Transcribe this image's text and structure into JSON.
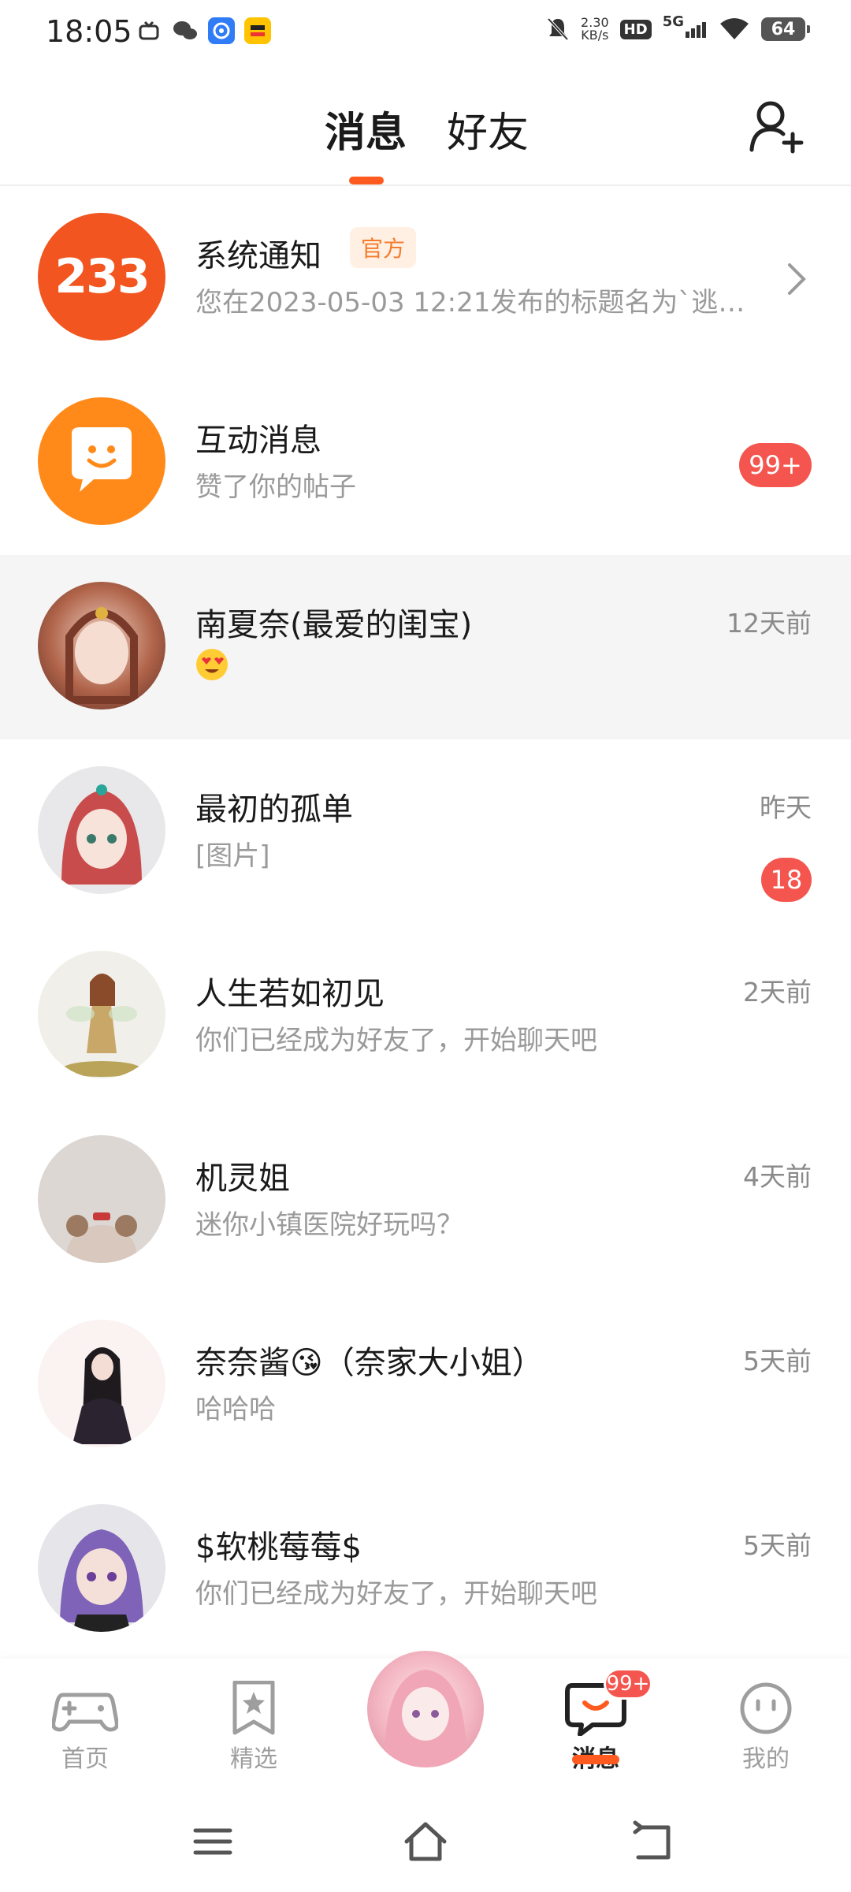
{
  "status_bar": {
    "time": "18:05",
    "net_speed_value": "2.30",
    "net_speed_unit": "KB/s",
    "hd": "HD",
    "signal": "5G",
    "battery": "64"
  },
  "header": {
    "tabs": [
      {
        "label": "消息",
        "active": true
      },
      {
        "label": "好友",
        "active": false
      }
    ]
  },
  "messages": [
    {
      "title": "系统通知",
      "tag": "官方",
      "subtitle": "您在2023-05-03 12:21发布的标题名为`逃…",
      "avatar_text": "233"
    },
    {
      "title": "互动消息",
      "subtitle": "赞了你的帖子",
      "badge": "99+"
    },
    {
      "title": "南夏奈(最爱的闺宝)",
      "subtitle": "",
      "time": "12天前"
    },
    {
      "title": "最初的孤单",
      "subtitle": "[图片]",
      "time": "昨天",
      "badge": "18"
    },
    {
      "title": "人生若如初见",
      "subtitle": "你们已经成为好友了，开始聊天吧",
      "time": "2天前"
    },
    {
      "title": "机灵姐",
      "subtitle": "迷你小镇医院好玩吗？",
      "time": "4天前"
    },
    {
      "title": "奈奈酱😘（奈家大小姐）",
      "subtitle": "哈哈哈",
      "time": "5天前"
    },
    {
      "title": "$软桃莓莓$",
      "subtitle": "你们已经成为好友了，开始聊天吧",
      "time": "5天前"
    }
  ],
  "bottom_nav": {
    "home": "首页",
    "featured": "精选",
    "messages": "消息",
    "messages_badge": "99+",
    "mine": "我的"
  },
  "colors": {
    "accent": "#ff5a1f",
    "badge": "#f4554e",
    "official_tag_bg": "#fff0e3",
    "official_tag_text": "#f47c2c",
    "highlight_row": "#f5f5f5"
  }
}
